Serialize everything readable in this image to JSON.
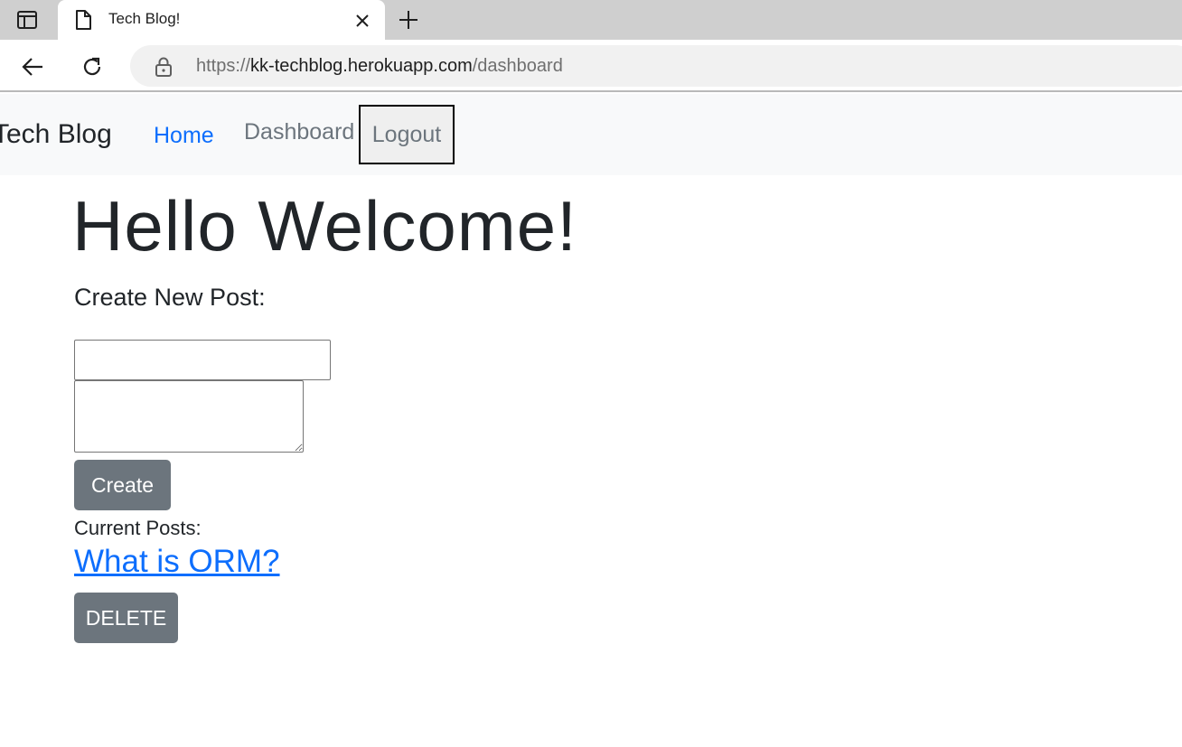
{
  "browser": {
    "tab_title": "Tech Blog!",
    "url_prefix": "https://",
    "url_host": "kk-techblog.herokuapp.com",
    "url_path": "/dashboard"
  },
  "navbar": {
    "brand": "Tech Blog",
    "home": "Home",
    "dashboard": "Dashboard",
    "logout": "Logout"
  },
  "main": {
    "heading": "Hello Welcome!",
    "create_label": "Create New Post:",
    "title_input_value": "",
    "body_input_value": "",
    "create_button": "Create",
    "current_posts_label": "Current Posts:",
    "posts": [
      {
        "title": "What is ORM?",
        "delete_label": "DELETE"
      }
    ]
  },
  "colors": {
    "link": "#0d6efd",
    "muted": "#6c757d",
    "button_bg": "#6c757d",
    "navbar_bg": "#f8f9fa"
  }
}
